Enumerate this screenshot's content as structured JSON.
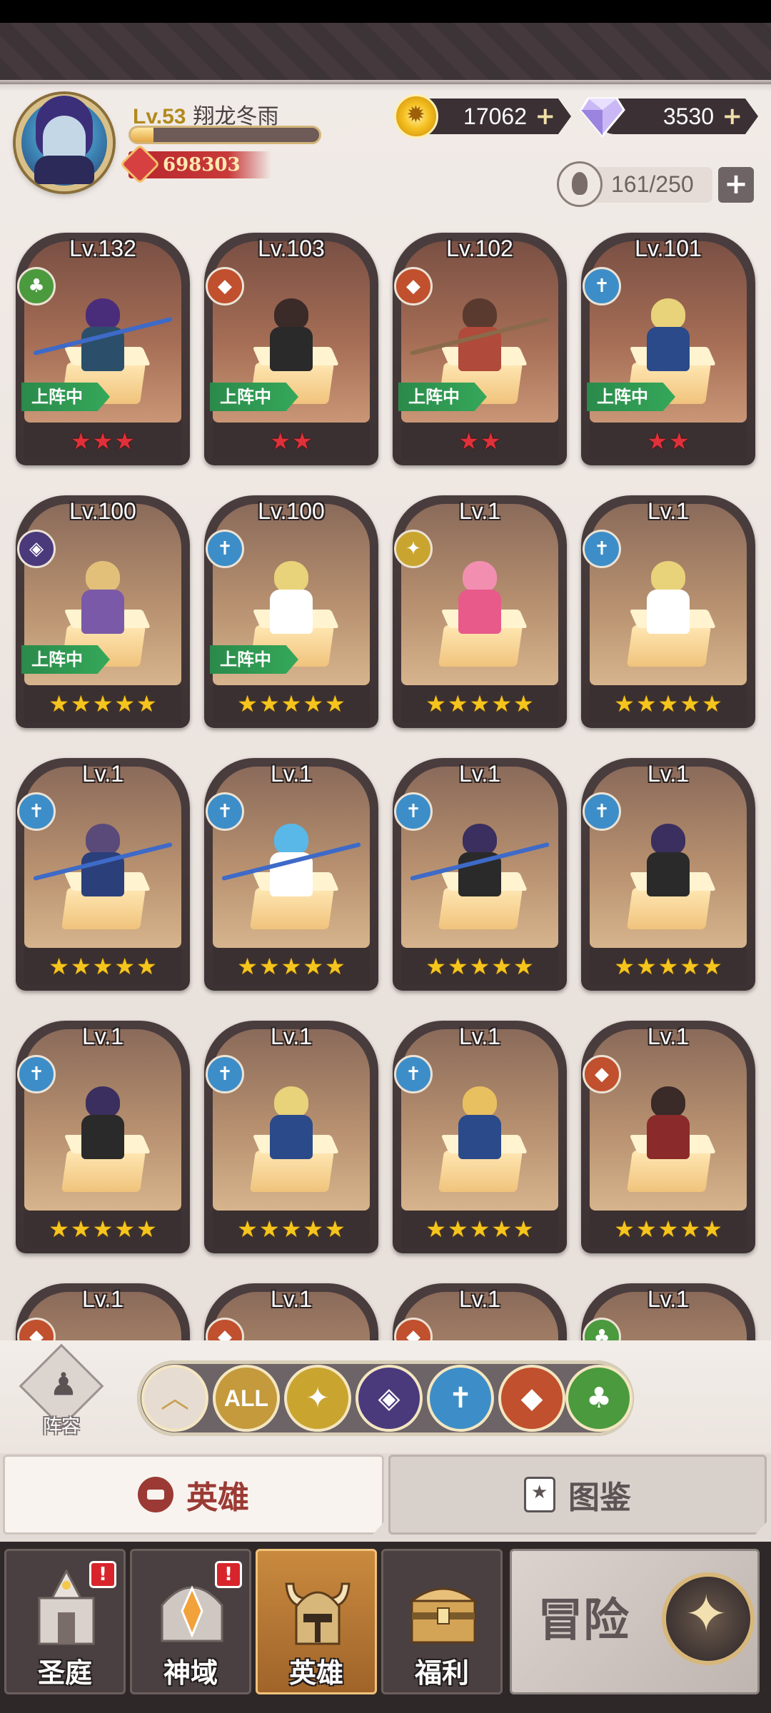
{
  "player": {
    "level": "Lv.53",
    "name": "翔龙冬雨",
    "exp_fraction": 0.12,
    "power": "698303"
  },
  "currency": {
    "gold": "17062",
    "gems": "3530",
    "plus": "+"
  },
  "hero_slots": {
    "value": "161/250",
    "plus": "+"
  },
  "heroes": [
    {
      "level": "Lv.132",
      "faction": "nature-icon",
      "deployed": "上阵中",
      "stars": 3,
      "star_color": "red"
    },
    {
      "level": "Lv.103",
      "faction": "beast-icon",
      "deployed": "上阵中",
      "stars": 2,
      "star_color": "red"
    },
    {
      "level": "Lv.102",
      "faction": "beast-icon",
      "deployed": "上阵中",
      "stars": 2,
      "star_color": "red"
    },
    {
      "level": "Lv.101",
      "faction": "holy-icon",
      "deployed": "上阵中",
      "stars": 2,
      "star_color": "red"
    },
    {
      "level": "Lv.100",
      "faction": "dark-icon",
      "deployed": "上阵中",
      "stars": 5,
      "star_color": "gold"
    },
    {
      "level": "Lv.100",
      "faction": "holy-icon",
      "deployed": "上阵中",
      "stars": 5,
      "star_color": "gold"
    },
    {
      "level": "Lv.1",
      "faction": "light-icon",
      "deployed": "",
      "stars": 5,
      "star_color": "gold"
    },
    {
      "level": "Lv.1",
      "faction": "holy-icon",
      "deployed": "",
      "stars": 5,
      "star_color": "gold"
    },
    {
      "level": "Lv.1",
      "faction": "holy-icon",
      "deployed": "",
      "stars": 5,
      "star_color": "gold"
    },
    {
      "level": "Lv.1",
      "faction": "holy-icon",
      "deployed": "",
      "stars": 5,
      "star_color": "gold"
    },
    {
      "level": "Lv.1",
      "faction": "holy-icon",
      "deployed": "",
      "stars": 5,
      "star_color": "gold"
    },
    {
      "level": "Lv.1",
      "faction": "holy-icon",
      "deployed": "",
      "stars": 5,
      "star_color": "gold"
    },
    {
      "level": "Lv.1",
      "faction": "holy-icon",
      "deployed": "",
      "stars": 5,
      "star_color": "gold"
    },
    {
      "level": "Lv.1",
      "faction": "holy-icon",
      "deployed": "",
      "stars": 5,
      "star_color": "gold"
    },
    {
      "level": "Lv.1",
      "faction": "holy-icon",
      "deployed": "",
      "stars": 5,
      "star_color": "gold"
    },
    {
      "level": "Lv.1",
      "faction": "beast-icon",
      "deployed": "",
      "stars": 5,
      "star_color": "gold"
    },
    {
      "level": "Lv.1",
      "faction": "beast-icon",
      "deployed": "",
      "stars": 0,
      "star_color": "gold"
    },
    {
      "level": "Lv.1",
      "faction": "beast-icon",
      "deployed": "",
      "stars": 0,
      "star_color": "gold"
    },
    {
      "level": "Lv.1",
      "faction": "beast-icon",
      "deployed": "",
      "stars": 0,
      "star_color": "gold"
    },
    {
      "level": "Lv.1",
      "faction": "nature-icon",
      "deployed": "",
      "stars": 0,
      "star_color": "gold"
    }
  ],
  "filters": {
    "formation_label": "阵容",
    "all_label": "ALL",
    "buttons": [
      "sort-icon",
      "all",
      "light-icon",
      "dark-icon",
      "holy-icon",
      "beast-icon",
      "nature-icon"
    ]
  },
  "tabs": {
    "hero": "英雄",
    "compendium": "图鉴"
  },
  "nav": {
    "items": [
      {
        "label": "圣庭",
        "badge": "!"
      },
      {
        "label": "神域",
        "badge": "!"
      },
      {
        "label": "英雄",
        "badge": ""
      },
      {
        "label": "福利",
        "badge": ""
      }
    ],
    "adventure": "冒险"
  },
  "colors": {
    "deployed_green": "#2a8a4a",
    "star_gold": "#f5c51e",
    "star_red": "#e0303a",
    "faction_holy": "#3d8ec8",
    "faction_beast": "#c0502e",
    "faction_nature": "#4b9a3e",
    "faction_dark": "#4a3a7c",
    "faction_light": "#c9a530"
  }
}
